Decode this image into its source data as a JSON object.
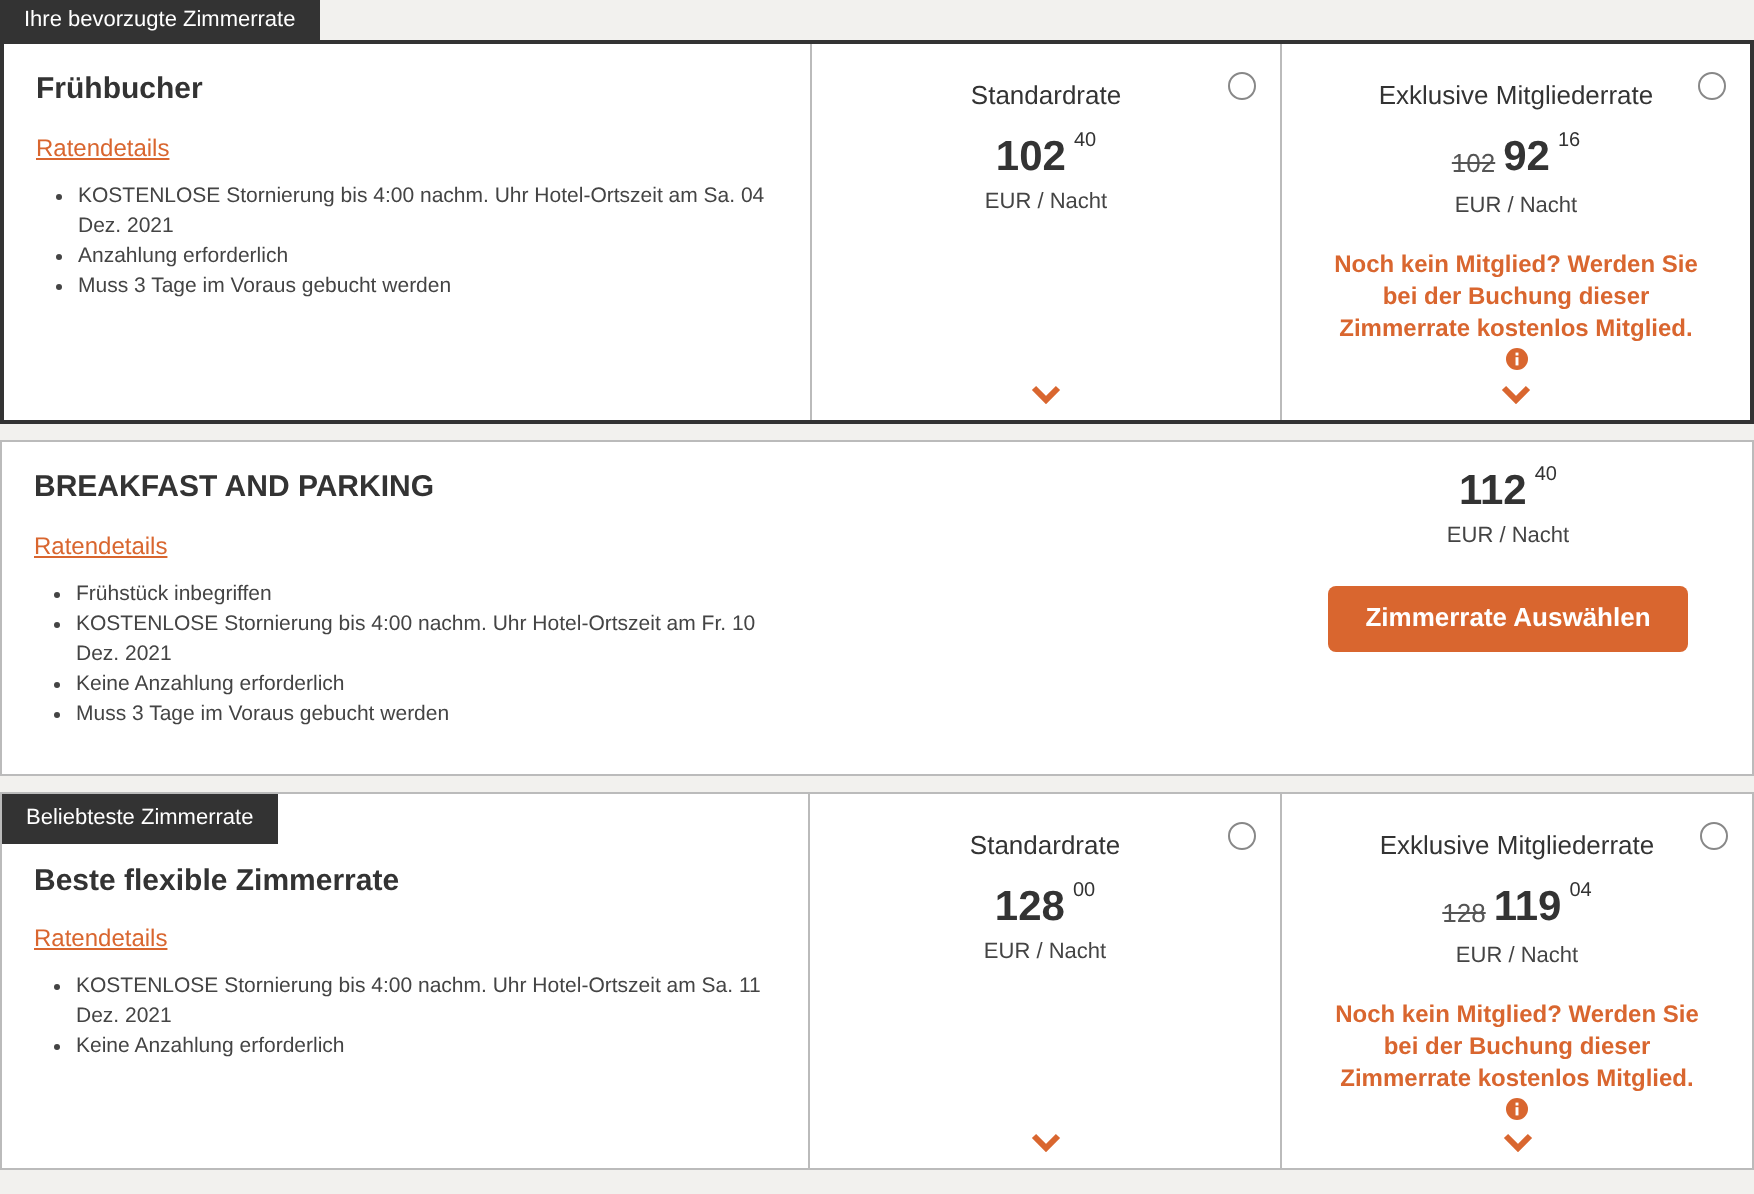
{
  "rates": [
    {
      "kind": "split",
      "tag": {
        "text": "Ihre bevorzugte Zimmerrate",
        "kind": "above"
      },
      "highlighted": true,
      "title": "Frühbucher",
      "details_link": "Ratendetails",
      "bullets": [
        "KOSTENLOSE Stornierung bis 4:00 nachm. Uhr Hotel-Ortszeit am Sa. 04 Dez. 2021",
        "Anzahlung erforderlich",
        "Muss 3 Tage im Voraus gebucht werden"
      ],
      "options": [
        {
          "label": "Standardrate",
          "selected": false,
          "price": "102",
          "cents": "40",
          "unit": "EUR / Nacht"
        },
        {
          "label": "Exklusive Mitgliederrate",
          "selected": false,
          "was": "102",
          "price": "92",
          "cents": "16",
          "unit": "EUR / Nacht",
          "note": "Noch kein Mitglied? Werden Sie bei der Buchung dieser Zimmerrate kostenlos Mitglied."
        }
      ]
    },
    {
      "kind": "single",
      "highlighted": false,
      "title": "BREAKFAST AND PARKING",
      "details_link": "Ratendetails",
      "bullets": [
        "Frühstück inbegriffen",
        "KOSTENLOSE Stornierung bis 4:00 nachm. Uhr Hotel-Ortszeit am Fr. 10 Dez. 2021",
        "Keine Anzahlung erforderlich",
        "Muss 3 Tage im Voraus gebucht werden"
      ],
      "price": "112",
      "cents": "40",
      "unit": "EUR / Nacht",
      "button": "Zimmerrate Auswählen"
    },
    {
      "kind": "split",
      "tag": {
        "text": "Beliebteste Zimmerrate",
        "kind": "inside"
      },
      "highlighted": false,
      "title": "Beste flexible Zimmerrate",
      "details_link": "Ratendetails",
      "bullets": [
        "KOSTENLOSE Stornierung bis 4:00 nachm. Uhr Hotel-Ortszeit am Sa. 11 Dez. 2021",
        "Keine Anzahlung erforderlich"
      ],
      "options": [
        {
          "label": "Standardrate",
          "selected": false,
          "price": "128",
          "cents": "00",
          "unit": "EUR / Nacht"
        },
        {
          "label": "Exklusive Mitgliederrate",
          "selected": false,
          "was": "128",
          "price": "119",
          "cents": "04",
          "unit": "EUR / Nacht",
          "note": "Noch kein Mitglied? Werden Sie bei der Buchung dieser Zimmerrate kostenlos Mitglied."
        }
      ]
    }
  ]
}
